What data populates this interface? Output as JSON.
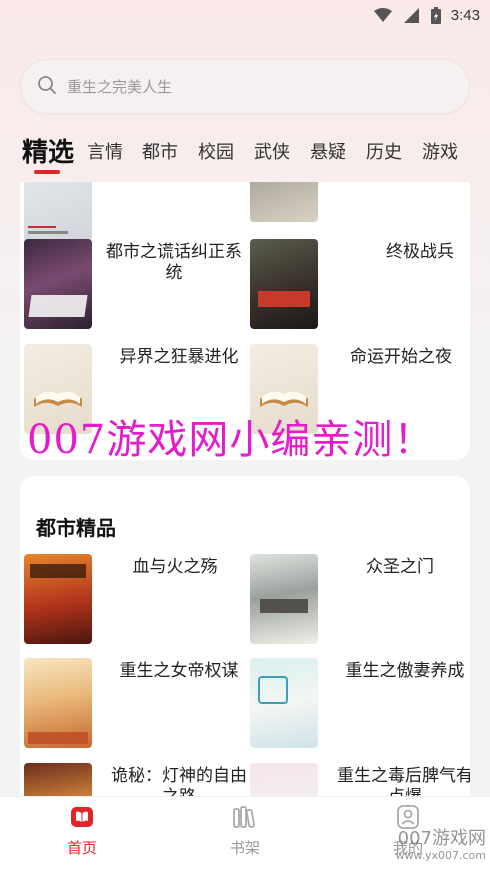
{
  "status_bar": {
    "time": "3:43"
  },
  "search": {
    "placeholder": "重生之完美人生"
  },
  "tabs": [
    "精选",
    "言情",
    "都市",
    "校园",
    "武侠",
    "悬疑",
    "历史",
    "游戏"
  ],
  "section1": {
    "books": [
      {
        "title": "都市之谎话纠正系统"
      },
      {
        "title": "终极战兵"
      },
      {
        "title": "异界之狂暴进化"
      },
      {
        "title": "命运开始之夜"
      }
    ]
  },
  "overlay_text": "007游戏网小编亲测！",
  "section2": {
    "title": "都市精品",
    "books": [
      {
        "title": "血与火之殇"
      },
      {
        "title": "众圣之门"
      },
      {
        "title": "重生之女帝权谋"
      },
      {
        "title": "重生之傲妻养成"
      },
      {
        "title": "诡秘：灯神的自由之路"
      },
      {
        "title": "重生之毒后脾气有点爆"
      }
    ]
  },
  "bottom_nav": [
    {
      "label": "首页",
      "icon": "book-open-icon",
      "active": true
    },
    {
      "label": "书架",
      "icon": "bookshelf-icon",
      "active": false
    },
    {
      "label": "我的",
      "icon": "profile-icon",
      "active": false
    }
  ],
  "site_watermark": {
    "brand": "007游戏网",
    "url": "www.yx007.com"
  },
  "colors": {
    "accent": "#e0252b",
    "overlay": "#e51ccc"
  }
}
